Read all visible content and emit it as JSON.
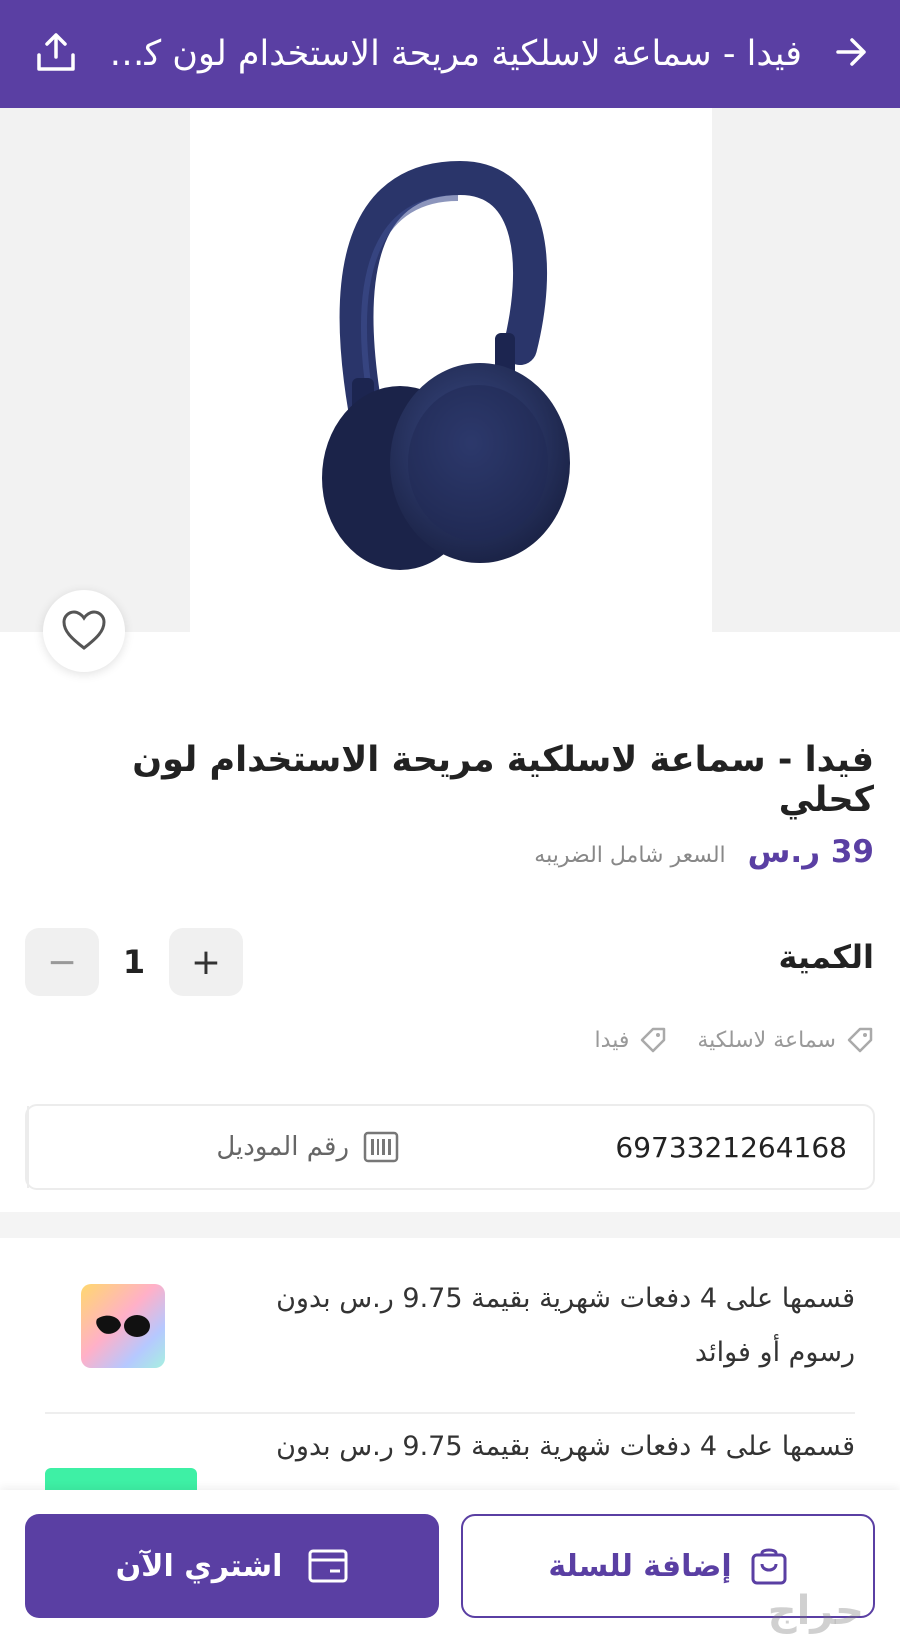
{
  "header": {
    "title": "فيدا - سماعة لاسلكية مريحة الاستخدام لون كحلي",
    "back_icon": "arrow-right-icon",
    "share_icon": "share-upload-icon"
  },
  "product": {
    "title": "فيدا - سماعة لاسلكية مريحة الاستخدام لون كحلي",
    "price": "39 ر.س",
    "price_note": "السعر شامل الضريبه",
    "image_desc": "navy-wireless-headphones"
  },
  "quantity": {
    "label": "الكمية",
    "value": "1",
    "plus": "+",
    "minus": "−"
  },
  "tags": [
    {
      "label": "سماعة لاسلكية"
    },
    {
      "label": "فيدا"
    }
  ],
  "model": {
    "label": "رقم الموديل",
    "value": "6973321264168"
  },
  "installments": [
    {
      "text": "قسمها على 4 دفعات شهرية بقيمة 9.75 ر.س بدون رسوم أو فوائد",
      "provider": "tamara"
    },
    {
      "text": "قسمها على 4 دفعات شهرية بقيمة 9.75 ر.س بدون",
      "provider": "tabby"
    }
  ],
  "actions": {
    "buy_now": "اشتري الآن",
    "add_to_cart": "إضافة للسلة"
  },
  "watermark": "حراج",
  "colors": {
    "brand": "#5a3fa3",
    "tabby": "#3ef0a5"
  }
}
